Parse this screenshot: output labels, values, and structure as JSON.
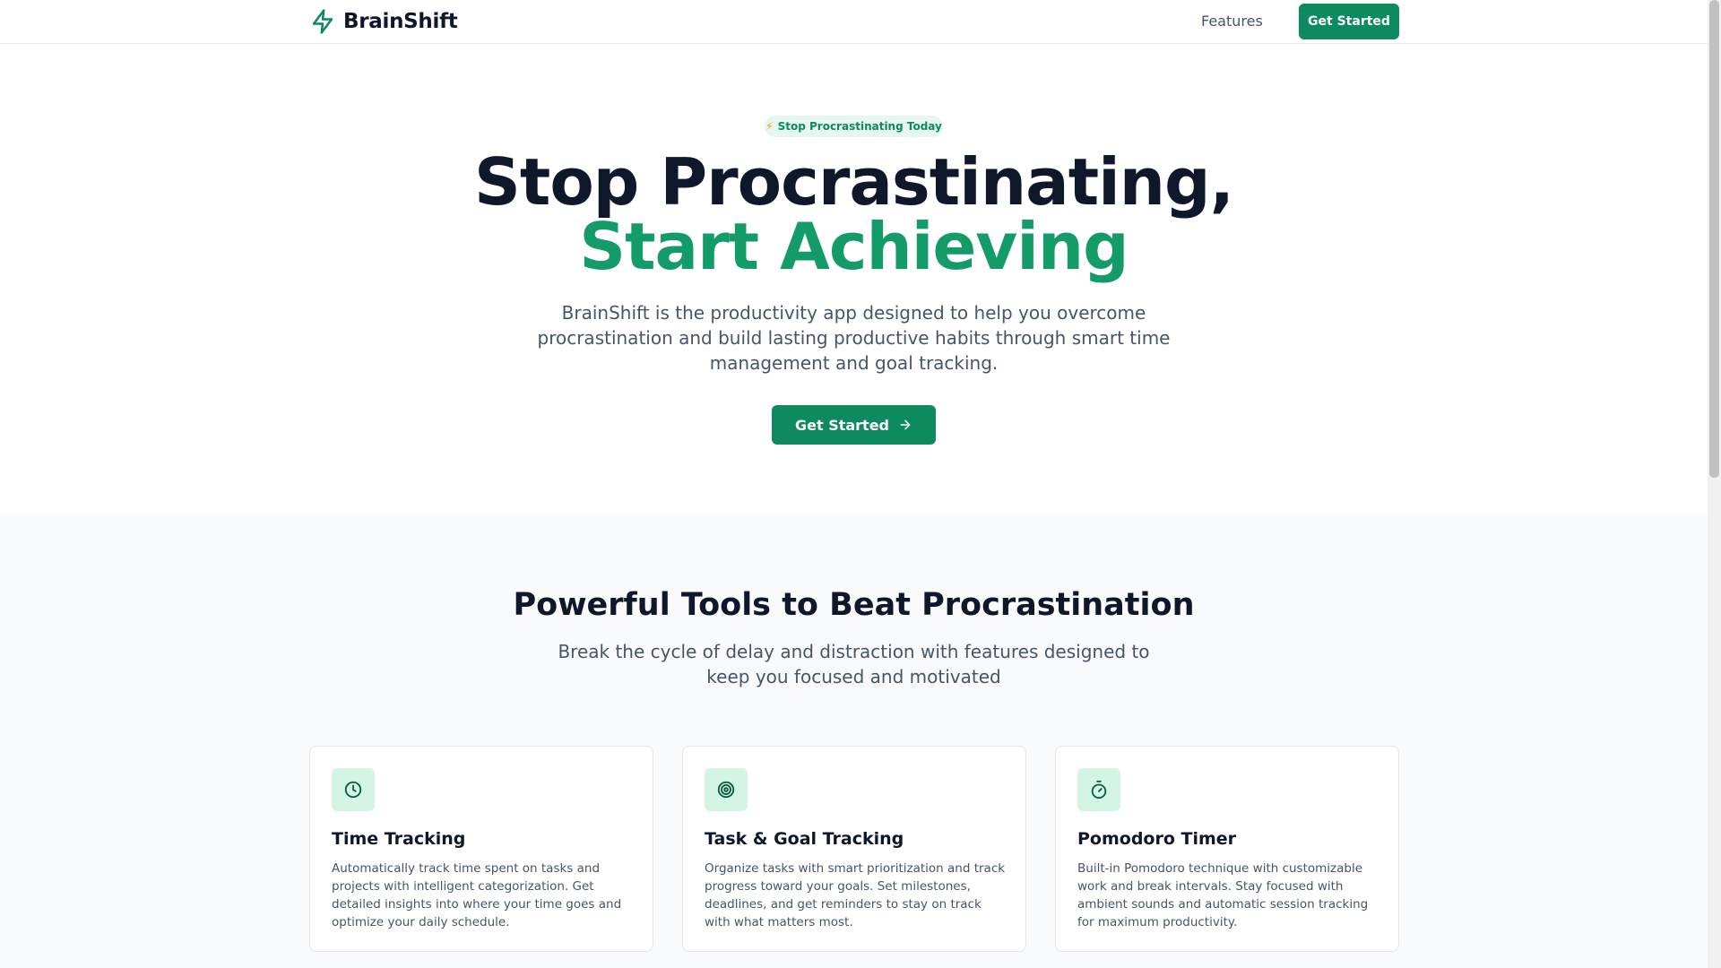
{
  "header": {
    "brand_name": "BrainShift",
    "brand_icon": "lightning-bolt-icon",
    "nav_features": "Features",
    "cta_label": "Get Started"
  },
  "hero": {
    "badge_icon": "⚡",
    "badge_text": "Stop Procrastinating Today",
    "title_line1": "Stop Procrastinating,",
    "title_line2": "Start Achieving",
    "description": "BrainShift is the productivity app designed to help you overcome procrastination and build lasting productive habits through smart time management and goal tracking.",
    "cta_label": "Get Started",
    "cta_icon": "arrow-right-icon"
  },
  "features": {
    "title": "Powerful Tools to Beat Procrastination",
    "subtitle": "Break the cycle of delay and distraction with features designed to keep you focused and motivated",
    "cards": [
      {
        "icon": "clock-icon",
        "title": "Time Tracking",
        "text": "Automatically track time spent on tasks and projects with intelligent categorization. Get detailed insights into where your time goes and optimize your daily schedule."
      },
      {
        "icon": "target-icon",
        "title": "Task & Goal Tracking",
        "text": "Organize tasks with smart prioritization and track progress toward your goals. Set milestones, deadlines, and get reminders to stay on track with what matters most."
      },
      {
        "icon": "stopwatch-icon",
        "title": "Pomodoro Timer",
        "text": "Built-in Pomodoro technique with customizable work and break intervals. Stay focused with ambient sounds and automatic session tracking for maximum productivity."
      }
    ]
  },
  "colors": {
    "brand_green": "#0e8a5f",
    "accent_green": "#149c68",
    "icon_bg": "#d4f5e6",
    "text_dark": "#0f172a",
    "text_muted": "#475569"
  }
}
